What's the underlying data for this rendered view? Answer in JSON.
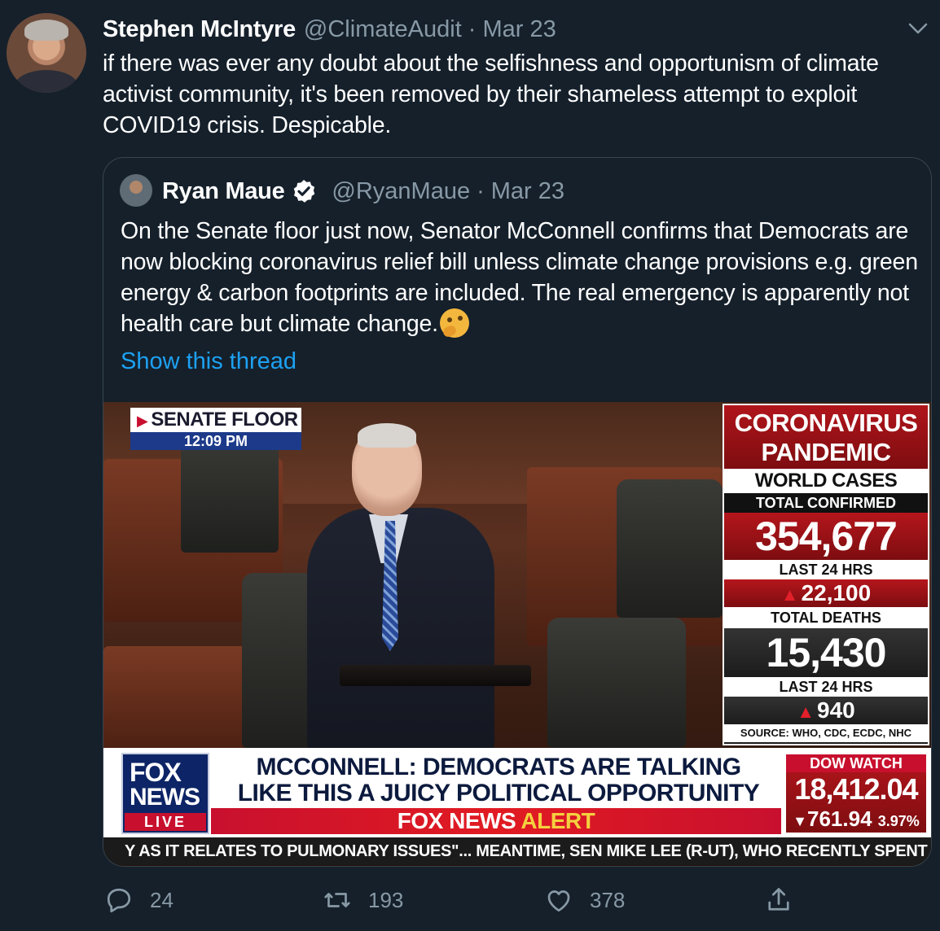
{
  "tweet": {
    "author_name": "Stephen McIntyre",
    "author_handle": "@ClimateAudit",
    "separator": "·",
    "date": "Mar 23",
    "text": "if there was ever any doubt about the selfishness and opportunism of climate activist community, it's been removed by their shameless attempt to exploit COVID19 crisis. Despicable."
  },
  "quoted": {
    "author_name": "Ryan Maue",
    "author_handle": "@RyanMaue",
    "separator": "·",
    "date": "Mar 23",
    "text": "On the Senate floor just now, Senator McConnell confirms that Democrats are now blocking coronavirus relief bill unless climate change provisions e.g. green energy & carbon footprints are included.  The real emergency is apparently not health care but climate change.",
    "show_thread": "Show this thread",
    "verified": true
  },
  "video": {
    "location_label": "SENATE FLOOR",
    "time": "12:09 PM",
    "panel": {
      "title_line1": "CORONAVIRUS",
      "title_line2": "PANDEMIC",
      "world_cases": "WORLD CASES",
      "total_confirmed_label": "TOTAL CONFIRMED",
      "total_confirmed": "354,677",
      "last24_label": "LAST 24 HRS",
      "confirmed_last24": "22,100",
      "total_deaths_label": "TOTAL DEATHS",
      "total_deaths": "15,430",
      "deaths_last24_label": "LAST 24 HRS",
      "deaths_last24": "940",
      "source": "SOURCE: WHO, CDC, ECDC, NHC"
    },
    "logo": {
      "line1": "FOX",
      "line2": "NEWS",
      "live": "LIVE"
    },
    "headline_line1": "MCCONNELL: DEMOCRATS ARE TALKING",
    "headline_line2": "LIKE THIS A JUICY POLITICAL OPPORTUNITY",
    "alert_part1": "FOX NEWS",
    "alert_part2": "ALERT",
    "dow": {
      "title": "DOW WATCH",
      "value": "18,412.04",
      "change": "761.94",
      "percent": "3.97%"
    },
    "ticker": "Y AS IT RELATES TO PULMONARY ISSUES\"...  MEANTIME, SEN MIKE LEE (R-UT), WHO RECENTLY SPENT TIME"
  },
  "actions": {
    "replies": "24",
    "retweets": "193",
    "likes": "378"
  },
  "colors": {
    "background": "#15202b",
    "secondary_text": "#8899a6",
    "link": "#1da1f2",
    "border": "#38444d"
  },
  "icons": [
    "chevron-down-icon",
    "verified-badge-icon",
    "thinking-face-emoji",
    "reply-icon",
    "retweet-icon",
    "like-icon",
    "share-icon"
  ]
}
